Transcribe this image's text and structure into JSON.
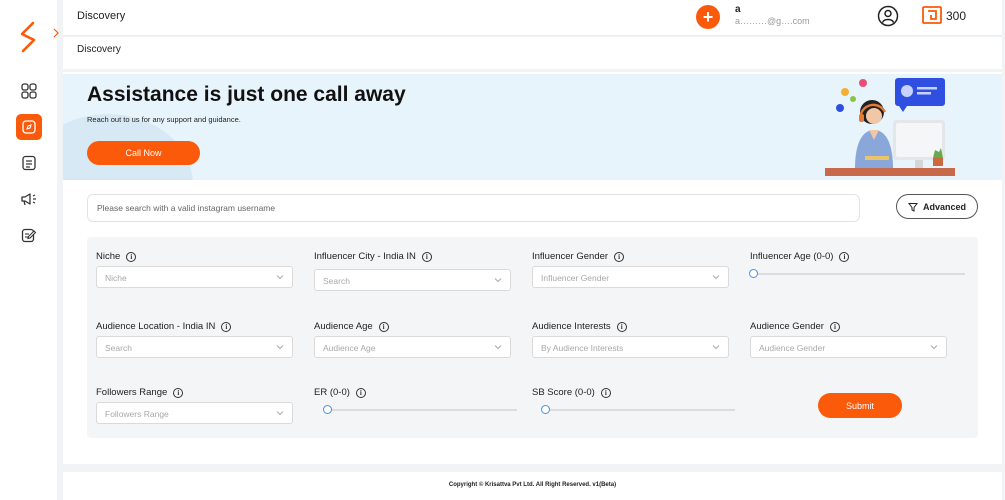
{
  "header": {
    "title": "Discovery",
    "user_name": "a",
    "user_email": "a………@g….com",
    "credits": "300"
  },
  "breadcrumb": "Discovery",
  "banner": {
    "title": "Assistance is just one call away",
    "subtitle": "Reach out to us for any support and guidance.",
    "call_button": "Call Now"
  },
  "search": {
    "placeholder": "Please search with a valid instagram username",
    "advanced_label": "Advanced"
  },
  "filters": {
    "niche": {
      "label": "Niche",
      "placeholder": "Niche"
    },
    "influencer_city": {
      "label": "Influencer City - India IN",
      "placeholder": "Search"
    },
    "influencer_gender": {
      "label": "Influencer Gender",
      "placeholder": "Influencer Gender"
    },
    "influencer_age": {
      "label": "Influencer Age  (0-0)",
      "value": 0
    },
    "audience_location": {
      "label": "Audience Location - India IN",
      "placeholder": "Search"
    },
    "audience_age": {
      "label": "Audience Age",
      "placeholder": "Audience Age"
    },
    "audience_interests": {
      "label": "Audience Interests",
      "placeholder": "By Audience Interests"
    },
    "audience_gender": {
      "label": "Audience Gender",
      "placeholder": "Audience Gender"
    },
    "followers_range": {
      "label": "Followers Range",
      "placeholder": "Followers Range"
    },
    "er": {
      "label": "ER  (0-0)",
      "value": 0
    },
    "sb_score": {
      "label": "SB Score  (0-0)",
      "value": 0
    },
    "submit_label": "Submit",
    "info_glyph": "i"
  },
  "footer": "Copyright © Krisattva Pvt Ltd. All Right Reserved.  v1(Beta)",
  "colors": {
    "accent": "#fa5a0a",
    "slider": "#4a90e2",
    "banner_bg": "#e8f4fb"
  },
  "icons": [
    "logo-icon",
    "chevron-right-icon",
    "grid-icon",
    "discovery-icon",
    "document-icon",
    "megaphone-icon",
    "edit-icon",
    "plus-icon",
    "user-circle-icon",
    "credit-icon",
    "filter-icon",
    "info-icon",
    "chevron-down-icon"
  ]
}
